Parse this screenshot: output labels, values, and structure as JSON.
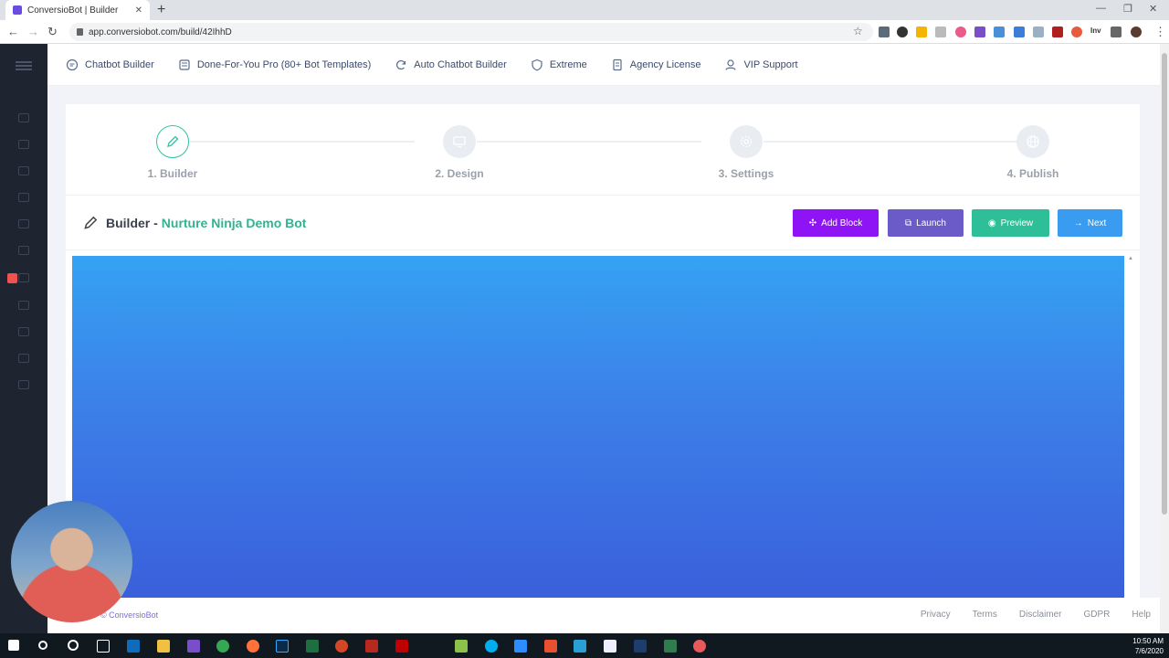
{
  "browser": {
    "tab_title": "ConversioBot | Builder",
    "url": "app.conversiobot.com/build/42IhhD",
    "extension_label": "Inv"
  },
  "topnav": {
    "items": [
      {
        "label": "Chatbot Builder",
        "icon": "chat-icon"
      },
      {
        "label": "Done-For-You Pro (80+ Bot Templates)",
        "icon": "template-icon"
      },
      {
        "label": "Auto Chatbot Builder",
        "icon": "refresh-icon"
      },
      {
        "label": "Extreme",
        "icon": "shield-icon"
      },
      {
        "label": "Agency License",
        "icon": "license-icon"
      },
      {
        "label": "VIP Support",
        "icon": "support-icon"
      }
    ]
  },
  "steps": [
    {
      "label": "1. Builder",
      "icon": "pencil-icon",
      "active": true
    },
    {
      "label": "2. Design",
      "icon": "monitor-icon",
      "active": false
    },
    {
      "label": "3. Settings",
      "icon": "gear-icon",
      "active": false
    },
    {
      "label": "4. Publish",
      "icon": "globe-icon",
      "active": false
    }
  ],
  "builder": {
    "prefix": "Builder -",
    "bot_name": "Nurture Ninja Demo Bot",
    "buttons": {
      "add_block": "Add Block",
      "launch": "Launch",
      "preview": "Preview",
      "next": "Next"
    }
  },
  "colors": {
    "accent_green": "#34b28f",
    "add_block": "#8f14f5",
    "launch": "#6a5bc9",
    "preview": "#2fbf98",
    "next": "#3a9cf0"
  },
  "footer": {
    "copyright": "© ConversioBot",
    "links": [
      "Privacy",
      "Terms",
      "Disclaimer",
      "GDPR",
      "Help"
    ]
  },
  "taskbar": {
    "time": "10:50 AM",
    "date": "7/6/2020"
  }
}
